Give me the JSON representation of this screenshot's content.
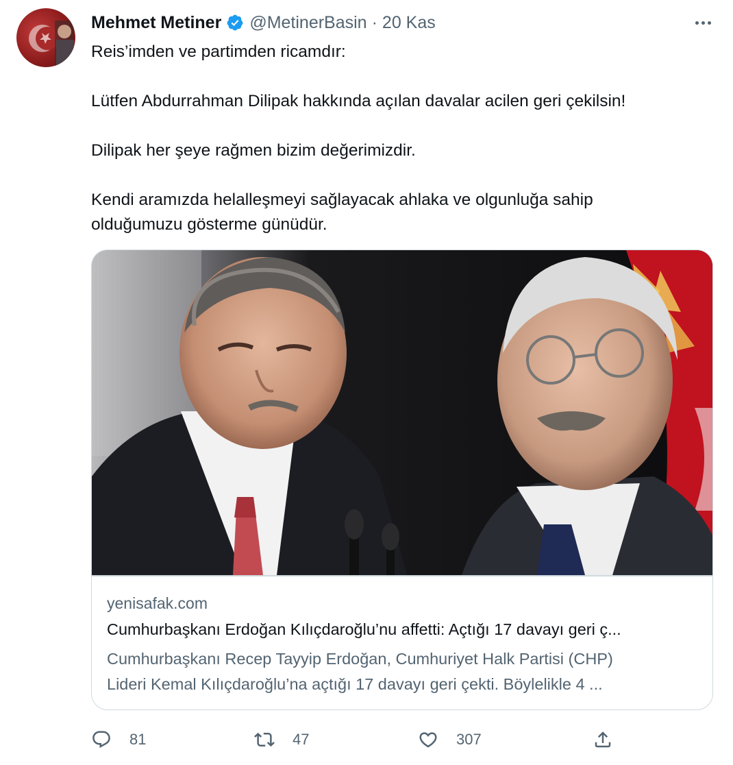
{
  "tweet": {
    "author": {
      "display_name": "Mehmet Metiner",
      "handle": "@MetinerBasin",
      "verified": true,
      "separator": "·",
      "date": "20 Kas"
    },
    "body_lines": [
      "Reis’imden ve partimden ricamdır:",
      "Lütfen Abdurrahman Dilipak hakkında açılan davalar acilen geri çekilsin!",
      "Dilipak her şeye rağmen bizim değerimizdir.",
      "Kendi aramızda helalleşmeyi sağlayacak ahlaka ve olgunluğa sahip",
      "olduğumuzu gösterme günüdür."
    ],
    "card": {
      "domain": "yenisafak.com",
      "title": "Cumhurbaşkanı Erdoğan Kılıçdaroğlu’nu affetti: Açtığı 17 davayı geri ç...",
      "description_lines": [
        "Cumhurbaşkanı Recep Tayyip Erdoğan, Cumhuriyet Halk Partisi (CHP)",
        "Lideri Kemal Kılıçdaroğlu’na açtığı 17 davayı geri çekti. Böylelikle 4 ..."
      ]
    },
    "actions": {
      "reply_count": "81",
      "retweet_count": "47",
      "like_count": "307"
    }
  },
  "icons": {
    "verified": "verified-badge-icon",
    "more": "more-options-icon",
    "reply": "reply-icon",
    "retweet": "retweet-icon",
    "like": "heart-icon",
    "share": "share-icon"
  },
  "colors": {
    "text_primary": "#0f1419",
    "text_secondary": "#536471",
    "verified_blue": "#1d9bf0",
    "border": "#cfd9de",
    "flag_red": "#e30a17"
  }
}
